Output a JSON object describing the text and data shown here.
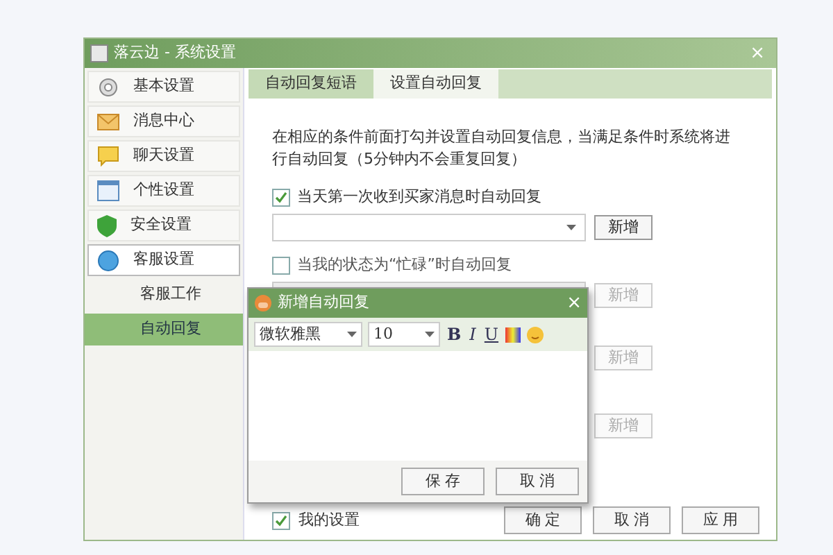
{
  "window": {
    "title": "落云边 - 系统设置",
    "close": "×"
  },
  "sidebar": {
    "items": [
      {
        "label": "基本设置",
        "selected": false
      },
      {
        "label": "消息中心",
        "selected": false
      },
      {
        "label": "聊天设置",
        "selected": false
      },
      {
        "label": "个性设置",
        "selected": false
      },
      {
        "label": "安全设置",
        "selected": false
      },
      {
        "label": "客服设置",
        "selected": true,
        "expanded": true,
        "children": [
          {
            "label": "客服工作",
            "selected": false
          },
          {
            "label": "自动回复",
            "selected": true
          }
        ]
      }
    ]
  },
  "tabs": [
    {
      "label": "自动回复短语",
      "selected": false
    },
    {
      "label": "设置自动回复",
      "selected": true
    }
  ],
  "description": "在相应的条件前面打勾并设置自动回复信息，当满足条件时系统将进行自动回复（5分钟内不会重复回复）",
  "conditions": [
    {
      "label": "当天第一次收到买家消息时自动回复",
      "checked": true,
      "button": "新增",
      "disabled": false
    },
    {
      "label": "当我的状态为“忙碌”时自动回复",
      "checked": false,
      "button": "新增",
      "disabled": true
    },
    {
      "button": "新增",
      "disabled": true
    },
    {
      "button": "新增",
      "disabled": true
    }
  ],
  "footer": {
    "checkbox": {
      "label": "我的设置",
      "checked": true
    },
    "buttons": [
      "确 定",
      "取 消",
      "应 用"
    ]
  },
  "dialog": {
    "title": "新增自动回复",
    "close": "×",
    "font": "微软雅黑",
    "size": "10",
    "format_buttons": [
      "B",
      "I",
      "U"
    ],
    "buttons": [
      "保 存",
      "取 消"
    ]
  }
}
